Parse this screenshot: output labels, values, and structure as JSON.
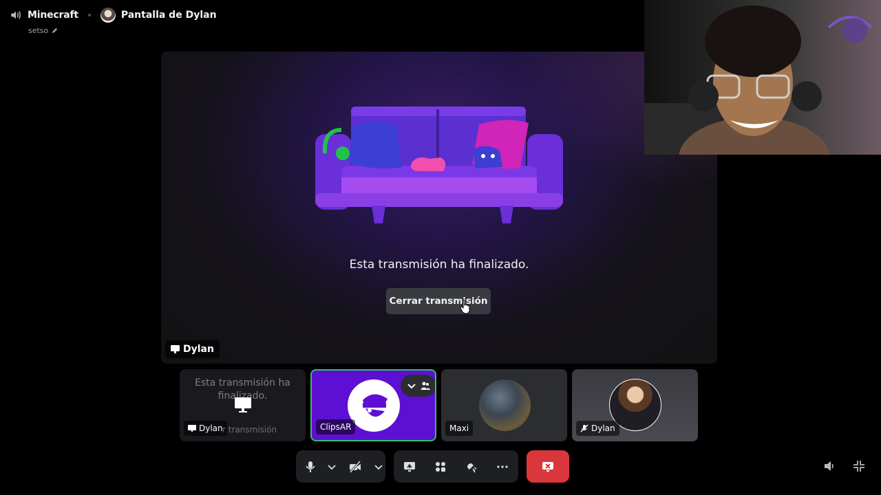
{
  "header": {
    "channel_name": "Minecraft",
    "stream_title": "Pantalla de Dylan",
    "topic": "setso"
  },
  "stage": {
    "ended_message": "Esta transmisión ha finalizado.",
    "close_button_label": "Cerrar transmisión",
    "streamer_name": "Dylan"
  },
  "tiles": [
    {
      "name": "Dylan",
      "message": "Esta transmisión ha finalizado.",
      "secondary_label": "r transmisión"
    },
    {
      "name": "ClipsAR"
    },
    {
      "name": "Maxi"
    },
    {
      "name": "Dylan"
    }
  ],
  "colors": {
    "accent_purple": "#5e0fd4",
    "speaking_border": "#2fbf71",
    "hangup_red": "#da373c"
  }
}
